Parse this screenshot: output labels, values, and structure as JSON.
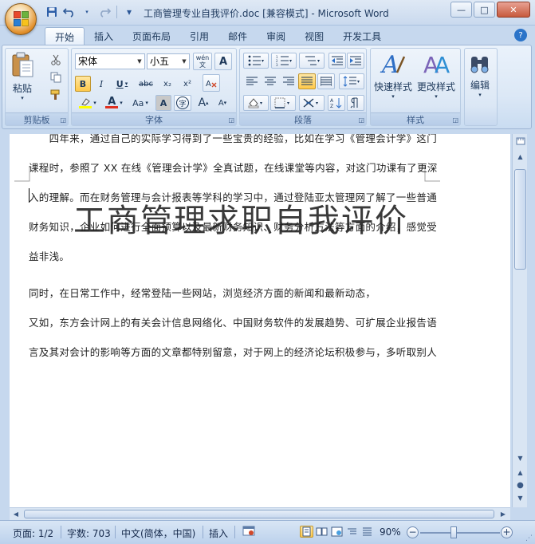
{
  "window": {
    "title": "工商管理专业自我评价.doc [兼容模式] - Microsoft Word",
    "minimize": "—",
    "maximize": "□",
    "close": "✕"
  },
  "qat": {
    "save_icon": "save-icon",
    "undo_icon": "undo-icon",
    "redo_icon": "redo-icon",
    "customize": "▾"
  },
  "tabs": [
    {
      "label": "开始",
      "active": true
    },
    {
      "label": "插入"
    },
    {
      "label": "页面布局"
    },
    {
      "label": "引用"
    },
    {
      "label": "邮件"
    },
    {
      "label": "审阅"
    },
    {
      "label": "视图"
    },
    {
      "label": "开发工具"
    }
  ],
  "help": "?",
  "ribbon": {
    "clipboard": {
      "label": "剪贴板",
      "paste": "粘贴"
    },
    "font": {
      "label": "字体",
      "font_name": "宋体",
      "font_size": "小五",
      "wen": "wén\n文",
      "A_box": "A",
      "bold": "B",
      "italic": "I",
      "underline": "U",
      "strike": "abc",
      "subscript": "x₂",
      "superscript": "x²",
      "change_case": "Aa",
      "shading": "A",
      "enclose": "字",
      "grow": "A",
      "shrink": "A",
      "highlight_icon": "highlighter-icon",
      "font_color": "A"
    },
    "paragraph": {
      "label": "段落"
    },
    "styles": {
      "label": "样式",
      "quick_styles": "快速样式",
      "change_styles": "更改样式"
    },
    "editing": {
      "label": "编辑"
    },
    "colors": {
      "highlight": "#ffff00",
      "font_red": "#e03020"
    }
  },
  "document": {
    "title": "工商管理求职自我评价",
    "lines": [
      "　　四年来，通过自己的实际学习得到了一些宝贵的经验，比如在学习《管理会计学》这门",
      "课程时，参照了 XX 在线《管理会计学》全真试题，在线课堂等内容，对这门功课有了更深",
      "入的理解。而在财务管理与会计报表等学科的学习中，通过登陆亚太管理网了解了一些普通",
      "财务知识，企业如何进行全面预算以及最新财务知识、财务分析方法等方面的介绍，感觉受",
      "益非浅。",
      "同时，在日常工作中，经常登陆一些网站，浏览经济方面的新闻和最新动态，",
      "又如，东方会计网上的有关会计信息网络化、中国财务软件的发展趋势、可扩展企业报告语",
      "言及其对会计的影响等方面的文章都特别留意，对于网上的经济论坛积极参与，多听取别人"
    ]
  },
  "status": {
    "page": "页面: 1/2",
    "words": "字数: 703",
    "language": "中文(简体，中国)",
    "insert_mode": "插入",
    "zoom": "90%",
    "zoom_out": "−",
    "zoom_in": "+"
  }
}
